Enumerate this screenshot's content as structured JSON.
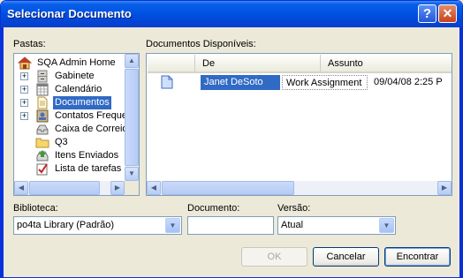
{
  "window": {
    "title": "Selecionar Documento",
    "help_glyph": "?",
    "close_glyph": "✕"
  },
  "folders": {
    "label": "Pastas:",
    "items": [
      {
        "label": "SQA Admin Home",
        "icon": "home-icon",
        "expander": ""
      },
      {
        "label": "Gabinete",
        "icon": "cabinet-icon",
        "expander": "+"
      },
      {
        "label": "Calendário",
        "icon": "calendar-icon",
        "expander": "+"
      },
      {
        "label": "Documentos",
        "icon": "documents-icon",
        "expander": "+",
        "selected": true
      },
      {
        "label": "Contatos Frequentes",
        "icon": "contacts-icon",
        "expander": "+"
      },
      {
        "label": "Caixa de Correio",
        "icon": "mailbox-icon",
        "expander": ""
      },
      {
        "label": "Q3",
        "icon": "folder-icon",
        "expander": ""
      },
      {
        "label": "Itens Enviados",
        "icon": "sent-items-icon",
        "expander": ""
      },
      {
        "label": "Lista de tarefas",
        "icon": "checklist-icon",
        "expander": ""
      }
    ]
  },
  "documents": {
    "label": "Documentos Disponíveis:",
    "columns": [
      "De",
      "Assunto"
    ],
    "rows": [
      {
        "icon": "document-icon",
        "from": "Janet DeSoto",
        "subject": "Work Assignment",
        "date": "09/04/08 2:25 P"
      }
    ]
  },
  "library": {
    "label": "Biblioteca:",
    "value": "po4ta Library  (Padrão)"
  },
  "document_field": {
    "label": "Documento:",
    "value": ""
  },
  "version": {
    "label": "Versão:",
    "value": "Atual"
  },
  "buttons": {
    "ok": "OK",
    "cancel": "Cancelar",
    "find": "Encontrar"
  },
  "colors": {
    "titlebar": "#0055e5",
    "selection": "#316ac5",
    "dialog_bg": "#ece9d8"
  }
}
